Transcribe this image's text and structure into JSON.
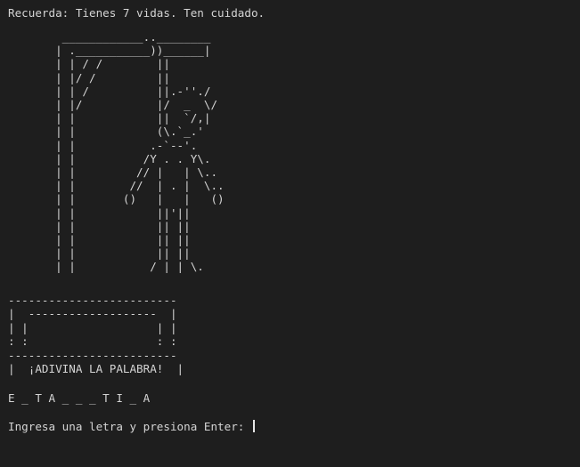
{
  "terminal": {
    "reminder": "Recuerda: Tienes 7 vidas. Ten cuidado.",
    "gallows_art": "        ____________..________\n       | .___________))______|\n       | | / /        ||\n       | |/ /         ||\n       | | /          ||.-''./\n       | |/           |/  _  \\/\n       | |            ||  `/,|\n       | |            (\\.`_.'\n       | |           .-`--'.\n       | |          /Y . . Y\\.\n       | |         // |   | \\..\n       | |        //  | . |  \\..\n       | |       ()   |   |   ()\n       | |            ||'||\n       | |            || ||\n       | |            || ||\n       | |            || ||\n       | |           / | | \\.",
    "banner_box": "-------------------------\n|  -------------------  |\n| |                   | |\n: :                   : :\n-------------------------\n|  ¡ADIVINA LA PALABRA!  |",
    "word_progress": "E _ T A _ _ _ T I _ A",
    "prompt": "Ingresa una letra y presiona Enter: "
  },
  "colors": {
    "background": "#1e1e1e",
    "text": "#d4d4d4"
  }
}
